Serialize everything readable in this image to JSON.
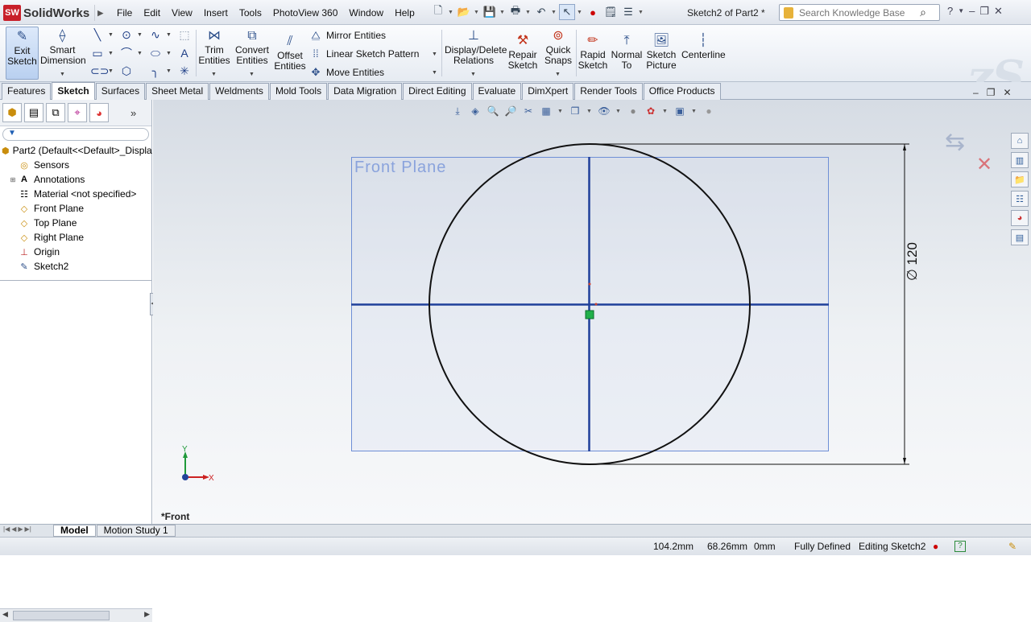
{
  "app": {
    "name": "SolidWorks",
    "doc_title": "Sketch2 of Part2 *"
  },
  "menu": [
    "File",
    "Edit",
    "View",
    "Insert",
    "Tools",
    "PhotoView 360",
    "Window",
    "Help"
  ],
  "search": {
    "placeholder": "Search Knowledge Base"
  },
  "ribbon": {
    "exit_sketch": "Exit Sketch",
    "smart_dimension": "Smart Dimension",
    "trim": "Trim Entities",
    "convert": "Convert Entities",
    "offset": "Offset Entities",
    "mirror": "Mirror Entities",
    "linear_pattern": "Linear Sketch Pattern",
    "move": "Move Entities",
    "display_delete": "Display/Delete Relations",
    "repair": "Repair Sketch",
    "quick_snaps": "Quick Snaps",
    "rapid_sketch": "Rapid Sketch",
    "normal_to": "Normal To",
    "sketch_picture": "Sketch Picture",
    "centerline": "Centerline"
  },
  "tabs": [
    "Features",
    "Sketch",
    "Surfaces",
    "Sheet Metal",
    "Weldments",
    "Mold Tools",
    "Data Migration",
    "Direct Editing",
    "Evaluate",
    "DimXpert",
    "Render Tools",
    "Office Products"
  ],
  "tree": {
    "root": "Part2  (Default<<Default>_Displa",
    "items": [
      "Sensors",
      "Annotations",
      "Material <not specified>",
      "Front Plane",
      "Top Plane",
      "Right Plane",
      "Origin",
      "Sketch2"
    ]
  },
  "viewport": {
    "plane_label": "Front Plane",
    "dimension": "∅ 120",
    "view_name": "*Front",
    "triad_y": "Y",
    "triad_x": "X"
  },
  "bottom_tabs": [
    "Model",
    "Motion Study 1"
  ],
  "status": {
    "x": "104.2mm",
    "y": "68.26mm",
    "z": "0mm",
    "state": "Fully Defined",
    "editing": "Editing Sketch2"
  },
  "colors": {
    "sketch_blue": "#1f3f9a",
    "plane_border": "#6e8fd6",
    "accent": "#c8202a"
  }
}
